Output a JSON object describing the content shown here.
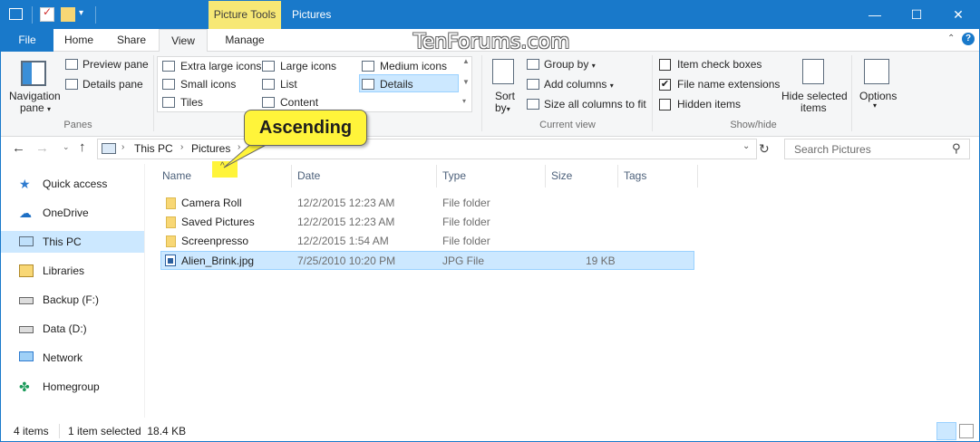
{
  "titlebar": {
    "context_tab": "Picture Tools",
    "title": "Pictures",
    "minimize": "—",
    "maximize": "☐",
    "close": "✕"
  },
  "tabs": [
    {
      "label": "File"
    },
    {
      "label": "Home"
    },
    {
      "label": "Share"
    },
    {
      "label": "View"
    },
    {
      "label": "Manage"
    }
  ],
  "watermark": "TenForums.com",
  "ribbon": {
    "navigation_pane": "Navigation",
    "navigation_pane2": "pane",
    "preview_pane": "Preview pane",
    "details_pane": "Details pane",
    "panes_label": "Panes",
    "layout": [
      "Extra large icons",
      "Large icons",
      "Medium icons",
      "Small icons",
      "List",
      "Details",
      "Tiles",
      "Content"
    ],
    "sort_by": "Sort",
    "sort_by2": "by",
    "group_by": "Group by",
    "add_columns": "Add columns",
    "size_all_columns": "Size all columns to fit",
    "current_view_label": "Current view",
    "item_check_boxes": "Item check boxes",
    "file_name_extensions": "File name extensions",
    "hidden_items": "Hidden items",
    "hide_selected_items": "Hide selected",
    "hide_selected_items2": "items",
    "show_hide_label": "Show/hide",
    "options": "Options"
  },
  "address": {
    "crumbs": [
      "This PC",
      "Pictures"
    ],
    "search_placeholder": "Search Pictures"
  },
  "nav": [
    {
      "label": "Quick access",
      "icon": "star-icon"
    },
    {
      "label": "OneDrive",
      "icon": "cloud-icon"
    },
    {
      "label": "This PC",
      "icon": "computer-icon"
    },
    {
      "label": "Libraries",
      "icon": "libraries-icon"
    },
    {
      "label": "Backup (F:)",
      "icon": "drive-icon"
    },
    {
      "label": "Data (D:)",
      "icon": "drive-icon"
    },
    {
      "label": "Network",
      "icon": "network-icon"
    },
    {
      "label": "Homegroup",
      "icon": "homegroup-icon"
    }
  ],
  "columns": [
    "Name",
    "Date",
    "Type",
    "Size",
    "Tags"
  ],
  "files": [
    {
      "name": "Camera Roll",
      "date": "12/2/2015 12:23 AM",
      "type": "File folder",
      "size": ""
    },
    {
      "name": "Saved Pictures",
      "date": "12/2/2015 12:23 AM",
      "type": "File folder",
      "size": ""
    },
    {
      "name": "Screenpresso",
      "date": "12/2/2015 1:54 AM",
      "type": "File folder",
      "size": ""
    },
    {
      "name": "Alien_Brink.jpg",
      "date": "7/25/2010 10:20 PM",
      "type": "JPG File",
      "size": "19 KB"
    }
  ],
  "status": {
    "items": "4 items",
    "selected": "1 item selected  18.4 KB"
  },
  "callout": "Ascending",
  "sort_indicator": "^"
}
